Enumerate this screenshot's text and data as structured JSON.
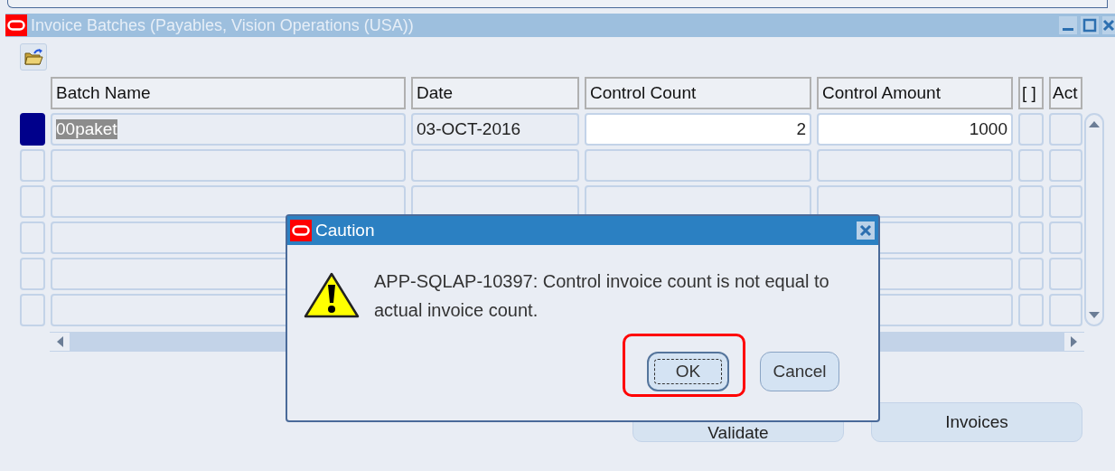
{
  "window": {
    "title": "Invoice Batches (Payables, Vision Operations (USA))"
  },
  "table": {
    "columns": [
      "Batch Name",
      "Date",
      "Control Count",
      "Control Amount",
      "[ ]",
      "Act"
    ],
    "rows": [
      {
        "selected": true,
        "batch_name": "00paket",
        "date": "03-OCT-2016",
        "control_count": "2",
        "control_amount": "1000"
      }
    ]
  },
  "buttons": [
    {
      "label": "Validate"
    },
    {
      "label": "Invoices"
    }
  ],
  "dialog": {
    "title": "Caution",
    "message": "APP-SQLAP-10397: Control invoice count is not equal to actual invoice count.",
    "buttons": [
      {
        "label": "OK",
        "default": true,
        "highlighted": true
      },
      {
        "label": "Cancel",
        "default": false,
        "highlighted": false
      }
    ]
  }
}
